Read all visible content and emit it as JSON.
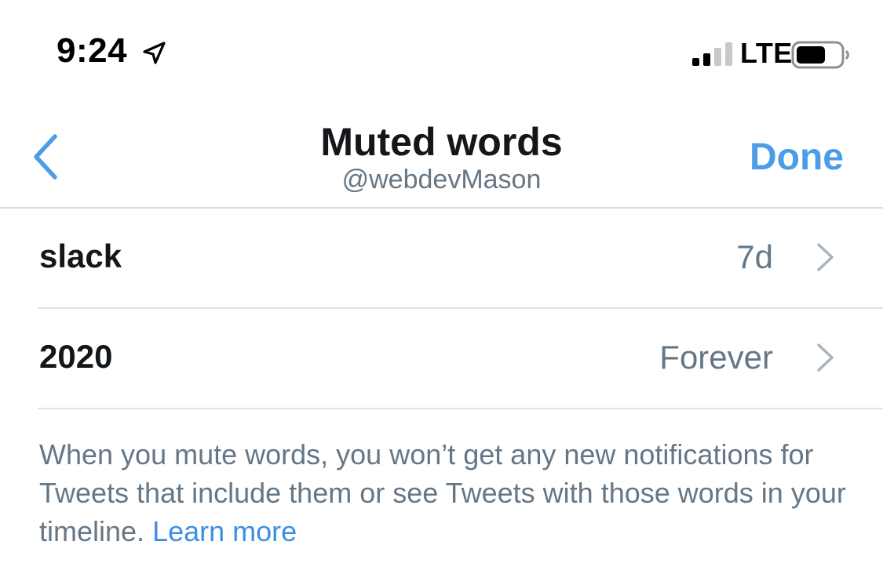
{
  "status_bar": {
    "time": "9:24",
    "network": "LTE",
    "icons": [
      "location-arrow-icon",
      "cellular-signal-icon",
      "battery-icon"
    ]
  },
  "nav": {
    "title": "Muted words",
    "subtitle": "@webdevMason",
    "done_label": "Done",
    "back_icon": "chevron-left-icon"
  },
  "muted_words": [
    {
      "word": "slack",
      "duration": "7d"
    },
    {
      "word": "2020",
      "duration": "Forever"
    }
  ],
  "description": {
    "text": "When you mute words, you won’t get any new notifications for Tweets that include them or see Tweets with those words in your timeline.",
    "link_label": "Learn more"
  },
  "colors": {
    "accent": "#4a9de6",
    "secondary_text": "#657786",
    "primary_text": "#14171a",
    "divider": "#dfe3e6"
  }
}
